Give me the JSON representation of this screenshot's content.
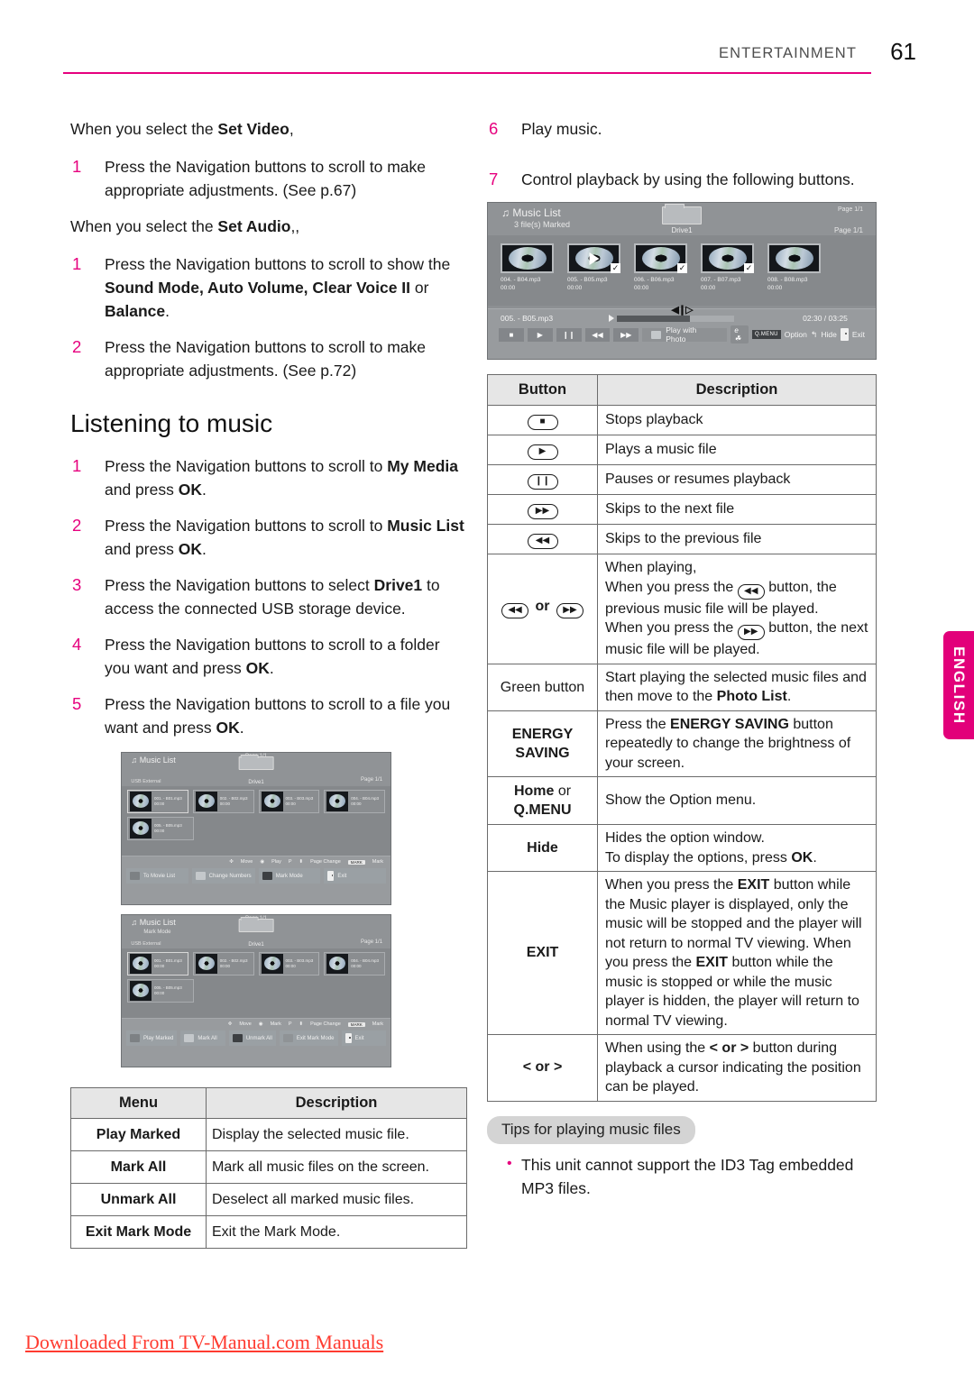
{
  "header": {
    "section": "ENTERTAINMENT",
    "page_number": "61"
  },
  "left_column": {
    "set_video_intro_pre": "When you select the ",
    "set_video_intro_bold": "Set Video",
    "set_video_intro_post": ",",
    "set_video_step": {
      "num": "1",
      "text": "Press the Navigation buttons to scroll to make appropriate adjustments. (See p.67)"
    },
    "set_audio_intro_pre": "When you select the ",
    "set_audio_intro_bold": "Set Audio",
    "set_audio_intro_post": ",,",
    "set_audio_steps": [
      {
        "num": "1",
        "pre": "Press the Navigation buttons to scroll to show the ",
        "bold1": "Sound Mode, Auto Volume, Clear Voice II",
        "mid": " or ",
        "bold2": "Balance",
        "post": "."
      },
      {
        "num": "2",
        "text": "Press the Navigation buttons to scroll to make appropriate adjustments. (See p.72)"
      }
    ],
    "section_title": "Listening to music",
    "music_steps": [
      {
        "num": "1",
        "pre": "Press the Navigation buttons to scroll to ",
        "bold1": "My Media",
        "mid": " and press ",
        "bold2": "OK",
        "post": "."
      },
      {
        "num": "2",
        "pre": "Press the Navigation buttons to scroll to ",
        "bold1": "Music List",
        "mid": " and press ",
        "bold2": "OK",
        "post": "."
      },
      {
        "num": "3",
        "pre": "Press the Navigation buttons to select ",
        "bold1": "Drive1",
        "mid": " to access the connected USB storage device.",
        "bold2": "",
        "post": ""
      },
      {
        "num": "4",
        "pre": "Press the Navigation buttons to scroll to a folder you want and press ",
        "bold1": "OK",
        "mid": "",
        "bold2": "",
        "post": "."
      },
      {
        "num": "5",
        "pre": "Press the Navigation buttons to scroll to a file you want and press ",
        "bold1": "OK",
        "mid": "",
        "bold2": "",
        "post": "."
      }
    ],
    "osd_browse": {
      "title": "Music List",
      "usb_label": "USB External",
      "drive_label": "Drive1",
      "page_top": "Page 1/1",
      "page_right": "Page 1/1",
      "files": [
        {
          "name": "001. - B01.mp3",
          "time": "00:00"
        },
        {
          "name": "002. - B02.mp3",
          "time": "00:00"
        },
        {
          "name": "003. - B03.mp3",
          "time": "00:00"
        },
        {
          "name": "004. - B04.mp3",
          "time": "00:00"
        },
        {
          "name": "005. - B05.mp3",
          "time": "00:00"
        }
      ],
      "hints": [
        "Move",
        "Play",
        "P",
        "Page Change",
        "MARK",
        "Mark"
      ],
      "buttons": [
        "To Movie List",
        "Change Numbers",
        "Mark Mode",
        "Exit"
      ]
    },
    "osd_mark": {
      "title": "Music List",
      "subtitle": "Mark Mode",
      "usb_label": "USB External",
      "drive_label": "Drive1",
      "page_top": "Page 1/1",
      "page_right": "Page 1/1",
      "files": [
        {
          "name": "001. - B01.mp3",
          "time": "00:00"
        },
        {
          "name": "002. - B02.mp3",
          "time": "00:00"
        },
        {
          "name": "003. - B03.mp3",
          "time": "00:00"
        },
        {
          "name": "004. - B04.mp3",
          "time": "00:00"
        },
        {
          "name": "005. - B05.mp3",
          "time": "00:00"
        }
      ],
      "hints": [
        "Move",
        "Mark",
        "P",
        "Page Change",
        "MARK",
        "Mark"
      ],
      "buttons": [
        "Play Marked",
        "Mark All",
        "Unmark All",
        "Exit Mark Mode",
        "Exit"
      ]
    },
    "menu_table": {
      "headers": [
        "Menu",
        "Description"
      ],
      "rows": [
        {
          "menu": "Play Marked",
          "desc": "Display the selected music file."
        },
        {
          "menu": "Mark All",
          "desc": "Mark all music files on the screen."
        },
        {
          "menu": "Unmark All",
          "desc": "Deselect all marked music files."
        },
        {
          "menu": "Exit Mark Mode",
          "desc": "Exit the Mark Mode."
        }
      ]
    }
  },
  "right_column": {
    "step6": {
      "num": "6",
      "text": "Play music."
    },
    "step7": {
      "num": "7",
      "text": "Control playback by using the following buttons."
    },
    "player_osd": {
      "title": "Music List",
      "subtitle": "3 file(s) Marked",
      "drive_label": "Drive1",
      "page_top": "Page 1/1",
      "page_right": "Page 1/1",
      "files": [
        {
          "name": "004. - B04.mp3",
          "time": "00:00",
          "playing": false,
          "marked": false
        },
        {
          "name": "005. - B05.mp3",
          "time": "00:00",
          "playing": true,
          "marked": true
        },
        {
          "name": "006. - B06.mp3",
          "time": "00:00",
          "playing": false,
          "marked": true
        },
        {
          "name": "007. - B07.mp3",
          "time": "00:00",
          "playing": false,
          "marked": true
        },
        {
          "name": "008. - B08.mp3",
          "time": "00:00",
          "playing": false,
          "marked": false
        }
      ],
      "now_playing": "005. - B05.mp3",
      "elapsed_total": "02:30 / 03:25",
      "play_with_photo": "Play with Photo",
      "option_label": "Option",
      "qmenu_badge": "Q.MENU",
      "hide_label": "Hide",
      "exit_label": "Exit"
    },
    "button_table": {
      "headers": [
        "Button",
        "Description"
      ],
      "rows": [
        {
          "key_icon": "■",
          "key_text": "",
          "desc": "Stops playback"
        },
        {
          "key_icon": "▶",
          "key_text": "",
          "desc": "Plays a music file"
        },
        {
          "key_icon": "❙❙",
          "key_text": "",
          "desc": "Pauses or resumes playback"
        },
        {
          "key_icon": "▶▶",
          "key_text": "",
          "desc": "Skips to the next file"
        },
        {
          "key_icon": "◀◀",
          "key_text": "",
          "desc": "Skips to the previous file"
        }
      ],
      "row_skip": {
        "key_prev": "◀◀",
        "key_or": "or",
        "key_next": "▶▶",
        "line1": "When playing,",
        "line2_a": "When you press the ",
        "line2_b": " button, the previous music file will be played.",
        "line3_a": "When you press the ",
        "line3_b": " button, the next music file will be played."
      },
      "row_green": {
        "key": "Green button",
        "desc_pre": "Start playing the selected music files and then move to the ",
        "desc_bold": "Photo List",
        "desc_post": "."
      },
      "row_energy": {
        "key": "ENERGY SAVING",
        "desc_pre": "Press the ",
        "desc_bold": "ENERGY SAVING",
        "desc_post": " button repeatedly to change the brightness of your screen."
      },
      "row_home": {
        "key_bold1": "Home",
        "key_mid": " or ",
        "key_bold2": "Q.MENU",
        "desc": "Show the Option menu."
      },
      "row_hide": {
        "key": "Hide",
        "desc_line1": "Hides the option window.",
        "desc_line2_pre": "To display the options, press ",
        "desc_line2_bold": "OK",
        "desc_line2_post": "."
      },
      "row_exit": {
        "key": "EXIT",
        "p1_a": "When you press the ",
        "p1_b": "EXIT",
        "p1_c": " button while the Music player is displayed, only the music will be stopped and the player will not return to normal TV viewing.",
        "p2_a": "When you press the ",
        "p2_b": "EXIT",
        "p2_c": " button while the music is stopped or while the music player is hidden, the player will return to normal TV viewing."
      },
      "row_lr": {
        "key": "< or >",
        "desc_pre": "When using the ",
        "desc_bold": "< or >",
        "desc_post": " button during playback a cursor indicating the position can be played."
      }
    },
    "tips": {
      "badge": "Tips for playing music files",
      "items": [
        "This unit cannot support the ID3 Tag embedded MP3 files."
      ]
    }
  },
  "lang_tab": {
    "label": "ENGLISH"
  },
  "footer": {
    "watermark": "Downloaded From TV-Manual.com Manuals"
  },
  "colors": {
    "accent": "#e6007e",
    "lang_tab": "#e2007a",
    "watermark": "#ff3b30"
  }
}
